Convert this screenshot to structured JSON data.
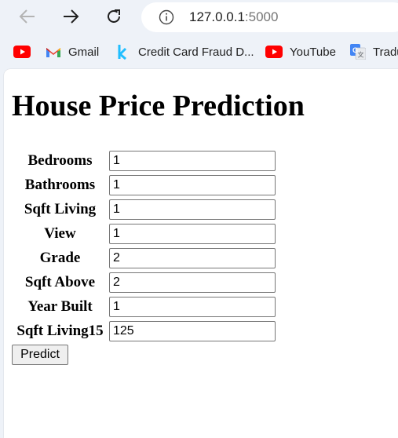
{
  "browser": {
    "url_host": "127.0.0.1",
    "url_port": ":5000",
    "bookmarks": [
      {
        "label": "",
        "icon": "youtube-icon"
      },
      {
        "label": "Gmail",
        "icon": "gmail-icon"
      },
      {
        "label": "Credit Card Fraud D...",
        "icon": "kaggle-icon"
      },
      {
        "label": "YouTube",
        "icon": "youtube-icon"
      },
      {
        "label": "Tradu",
        "icon": "google-translate-icon"
      }
    ]
  },
  "page": {
    "title": "House Price Prediction",
    "fields": [
      {
        "label": "Bedrooms",
        "value": "1"
      },
      {
        "label": "Bathrooms",
        "value": "1"
      },
      {
        "label": "Sqft Living",
        "value": "1"
      },
      {
        "label": "View",
        "value": "1"
      },
      {
        "label": "Grade",
        "value": "2"
      },
      {
        "label": "Sqft Above",
        "value": "2"
      },
      {
        "label": "Year Built",
        "value": "1"
      },
      {
        "label": "Sqft Living15",
        "value": "125"
      }
    ],
    "submit_label": "Predict"
  }
}
